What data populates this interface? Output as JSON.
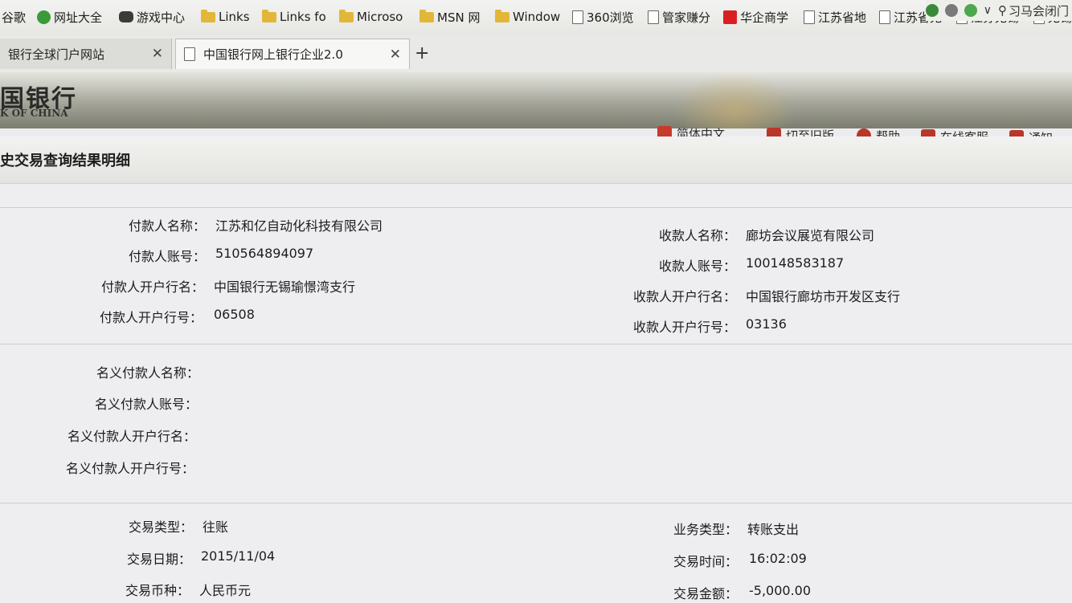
{
  "bookmarks": [
    {
      "label": "谷歌",
      "icon": "none"
    },
    {
      "label": "网址大全",
      "icon": "green-circle-icon"
    },
    {
      "label": "游戏中心",
      "icon": "gamepad-icon"
    },
    {
      "label": "Links",
      "icon": "folder-icon"
    },
    {
      "label": "Links fo",
      "icon": "folder-icon"
    },
    {
      "label": "Microso",
      "icon": "folder-icon"
    },
    {
      "label": "MSN 网",
      "icon": "folder-icon"
    },
    {
      "label": "Window",
      "icon": "folder-icon"
    },
    {
      "label": "360浏览",
      "icon": "page-icon"
    },
    {
      "label": "管家赚分",
      "icon": "page-icon"
    },
    {
      "label": "华企商学",
      "icon": "red-logo-icon"
    },
    {
      "label": "江苏省地",
      "icon": "page-icon"
    },
    {
      "label": "江苏省无",
      "icon": "page-icon"
    },
    {
      "label": "江苏无锡",
      "icon": "page-icon"
    },
    {
      "label": "无锡",
      "icon": "page-icon"
    }
  ],
  "toolbar": {
    "search_text": "习马会闭门"
  },
  "tabs": [
    {
      "label": "银行全球门户网站"
    },
    {
      "label": "中国银行网上银行企业2.0"
    }
  ],
  "bank": {
    "logo_cn": "国银行",
    "logo_en": "K OF CHINA",
    "nav": [
      "简体中文",
      "切至旧版",
      "帮助",
      "在线客服",
      "通知"
    ]
  },
  "page_title": "史交易查询结果明细",
  "payer": {
    "name_label": "付款人名称：",
    "name": "江苏和亿自动化科技有限公司",
    "account_label": "付款人账号：",
    "account": "510564894097",
    "bank_label": "付款人开户行名：",
    "bank": "中国银行无锡瑜憬湾支行",
    "bank_no_label": "付款人开户行号：",
    "bank_no": "06508"
  },
  "payee": {
    "name_label": "收款人名称：",
    "name": "廊坊会议展览有限公司",
    "account_label": "收款人账号：",
    "account": "100148583187",
    "bank_label": "收款人开户行名：",
    "bank": "中国银行廊坊市开发区支行",
    "bank_no_label": "收款人开户行号：",
    "bank_no": "03136"
  },
  "nominal": {
    "name_label": "名义付款人名称：",
    "account_label": "名义付款人账号：",
    "bank_label": "名义付款人开户行名：",
    "bank_no_label": "名义付款人开户行号："
  },
  "transaction": {
    "type_label": "交易类型：",
    "type": "往账",
    "date_label": "交易日期：",
    "date": "2015/11/04",
    "currency_label": "交易币种：",
    "currency": "人民币元",
    "biz_label": "业务类型：",
    "biz": "转账支出",
    "time_label": "交易时间：",
    "time": "16:02:09",
    "amount_label": "交易金额：",
    "amount": "-5,000.00"
  }
}
